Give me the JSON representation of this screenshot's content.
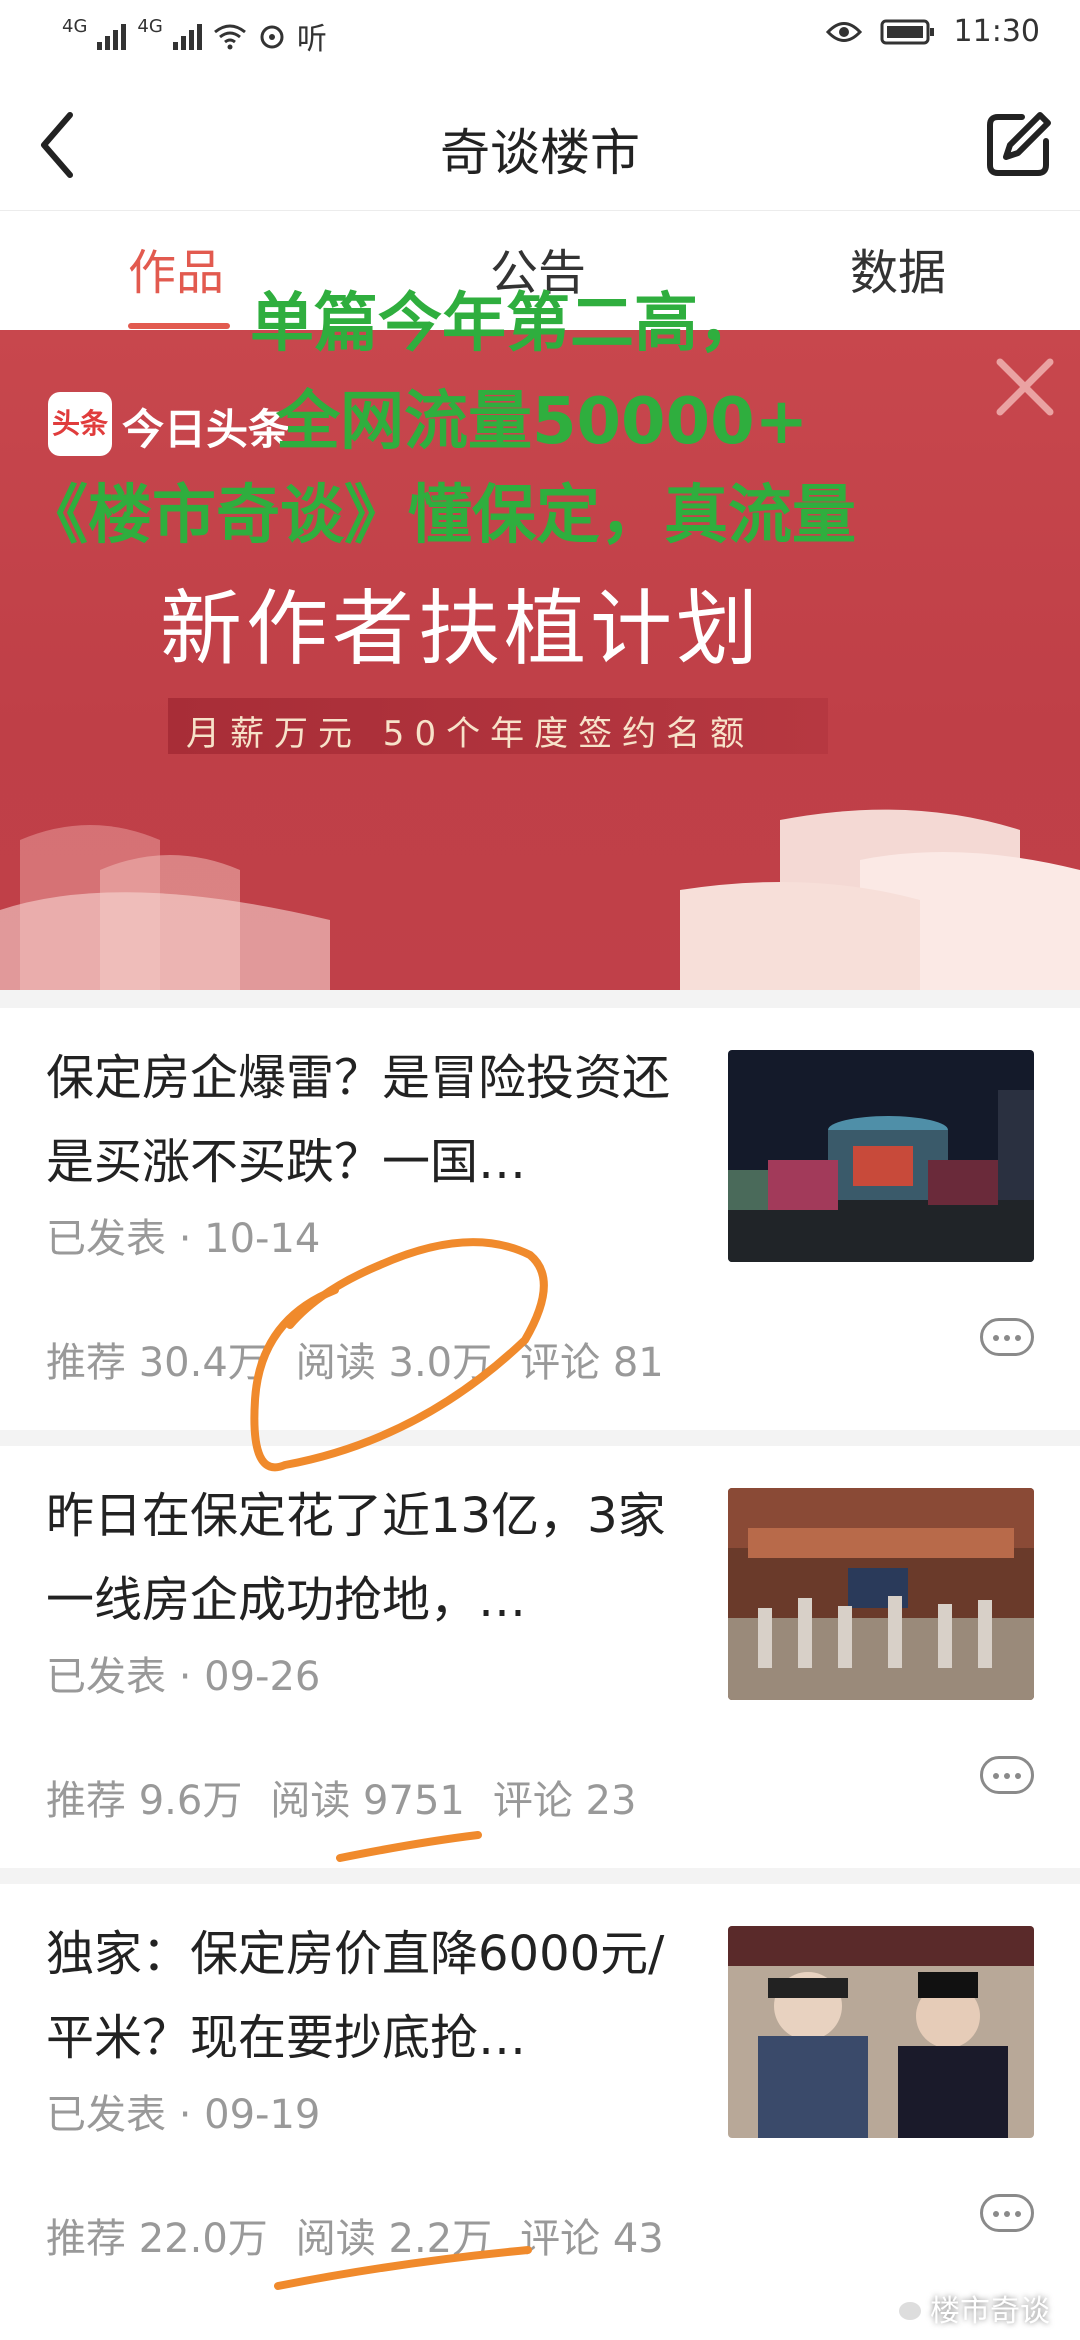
{
  "status_bar": {
    "signal_left": "4G",
    "signal_right": "4G",
    "extra": "听",
    "time": "11:30"
  },
  "nav": {
    "title": "奇谈楼市"
  },
  "tabs": [
    {
      "label": "作品",
      "active": true
    },
    {
      "label": "公告",
      "active": false
    },
    {
      "label": "数据",
      "active": false
    }
  ],
  "banner": {
    "logo_glyph": "头条",
    "logo_text": "今日头条",
    "main": "新作者扶植计划",
    "sub": "月薪万元 50个年度签约名额"
  },
  "overlay": {
    "line1": "单篇今年第二高，",
    "line2": "全网流量50000+",
    "line3": "《楼市奇谈》懂保定，真流量",
    "color": "#2fae3e"
  },
  "articles": [
    {
      "title": "保定房企爆雷？是冒险投资还是买涨不买跌？一国…",
      "date": "已发表 · 10-14",
      "recommend": "推荐 30.4万",
      "read": "阅读 3.0万",
      "comment": "评论 81"
    },
    {
      "title": "昨日在保定花了近13亿，3家一线房企成功抢地，…",
      "date": "已发表 · 09-26",
      "recommend": "推荐 9.6万",
      "read": "阅读 9751",
      "comment": "评论 23"
    },
    {
      "title": "独家：保定房价直降6000元/平米？现在要抄底抢…",
      "date": "已发表 · 09-19",
      "recommend": "推荐 22.0万",
      "read": "阅读 2.2万",
      "comment": "评论 43"
    }
  ],
  "watermark": "楼市奇谈",
  "colors": {
    "accent": "#e25a4f",
    "banner": "#c4444b",
    "annotation": "#f08a2c"
  }
}
